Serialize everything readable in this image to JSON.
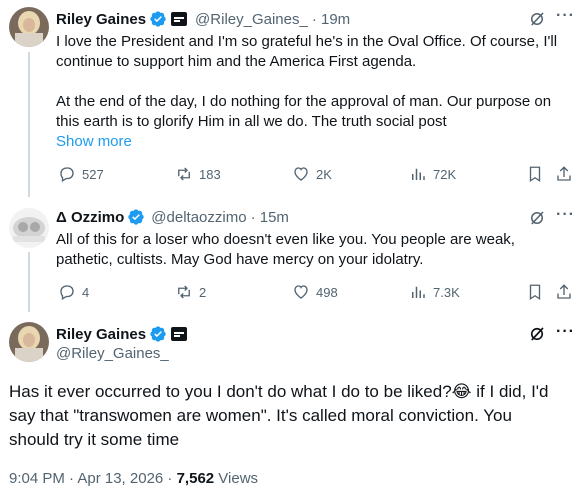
{
  "post1": {
    "name": "Riley Gaines",
    "handle": "@Riley_Gaines_",
    "time": "· 19m",
    "text_line1": "I love the President and I'm so grateful he's in the Oval Office. Of course, I'll",
    "text_line2": "continue to support him and the America First agenda.",
    "text_line3": "At the end of the day, I do nothing for the approval of man. Our purpose on",
    "text_line4": "this earth is to glorify Him in all we do. The truth social post",
    "show_more": "Show more",
    "replies": "527",
    "reposts": "183",
    "likes": "2K",
    "views": "72K"
  },
  "post2": {
    "name": "Δ Ozzimo",
    "handle": "@deltaozzimo",
    "time": "· 15m",
    "text_line1": "All of this for a loser who doesn't even like you. You people are weak,",
    "text_line2": "pathetic, cultists. May God have mercy on your idolatry.",
    "replies": "4",
    "reposts": "2",
    "likes": "498",
    "views": "7.3K"
  },
  "main": {
    "name": "Riley Gaines",
    "handle": "@Riley_Gaines_",
    "text_line1_a": "Has it ever occurred to you I don't do what I do to be liked?",
    "emoji": "😂",
    "text_line1_b": " if I did, I'd",
    "text_line2": "say that \"transwomen are women\". It's called moral conviction. You",
    "text_line3": "should try it some time",
    "timestamp": "9:04 PM · Apr 13, 2026 · ",
    "views_count": "7,562",
    "views_label": " Views"
  },
  "colors": {
    "accent": "#1d9bf0",
    "muted": "#536471",
    "text": "#0f1419"
  }
}
